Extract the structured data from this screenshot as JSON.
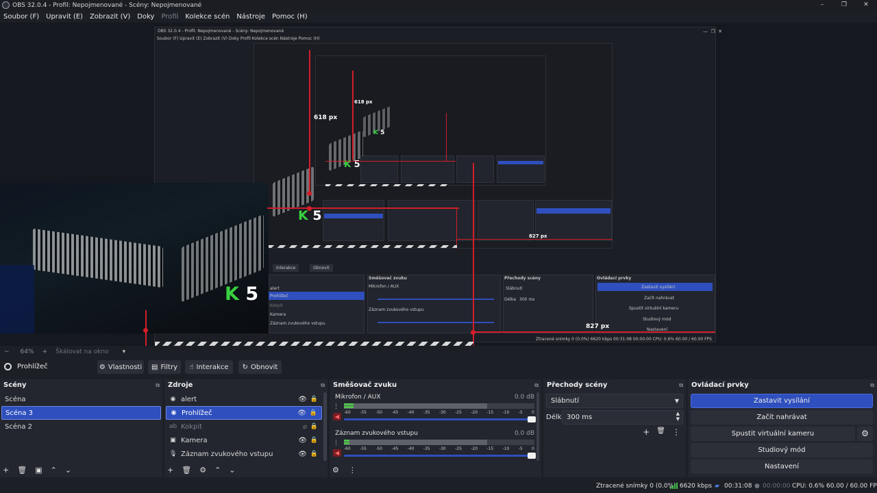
{
  "window": {
    "title": "OBS 32.0.4 - Profil: Nepojmenované - Scény: Nepojmenované",
    "controls": [
      "–",
      "❐",
      "✕"
    ]
  },
  "menu": [
    "Soubor (F)",
    "Upravit (E)",
    "Zobrazit (V)",
    "Doky",
    "Profil",
    "Kolekce scén",
    "Nástroje",
    "Pomoc (H)"
  ],
  "preview": {
    "px_label_1": "618 px",
    "px_label_2": "618 px",
    "px_label_3": "827 px",
    "px_label_4": "827 px",
    "logo": "5",
    "logo_k": "K",
    "nested_title": "OBS 32.0.4 - Profil: Nepojmenované - Scény: Nepojmenované",
    "nested_menu": "Soubor (F)   Upravit (E)   Zobrazit (V)   Doky   Profil   Kolekce scén   Nástroje   Pomoc (H)",
    "nested_interakce": "Interakce",
    "nested_obnovit": "Obnovit",
    "nested_sources": [
      "alert",
      "Prohlížeč",
      "Kokpit",
      "Kamera",
      "Záznam zvukového vstupu"
    ],
    "nested_mixer_title": "Směšovač zvuku",
    "nested_transitions_title": "Přechody scény",
    "nested_controls_title": "Ovládací prvky",
    "nested_controls": [
      "Zastavit vysílání",
      "Začít nahrávat",
      "Spustit virtuální kameru",
      "Studiový mód",
      "Nastavení"
    ],
    "nested_fade": "Slábnutí",
    "nested_duration_label": "Délka",
    "nested_duration": "300 ms",
    "nested_ch1": "Mikrofon / AUX",
    "nested_ch2": "Záznam zvukového vstupu",
    "nested_status": "Ztracené snímky 0 (0.0%)    6620 kbps    00:31:08    00:00:00    CPU: 0.6%    60.00 / 60.00 FPS"
  },
  "zoom": {
    "minus": "−",
    "value": "64%",
    "plus": "+",
    "scale_mode": "Škálovat na okno",
    "caret": "▾"
  },
  "source_toolbar": {
    "name": "Prohlížeč",
    "properties": "Vlastnosti",
    "filters": "Filtry",
    "interact": "Interakce",
    "refresh": "Obnovit"
  },
  "scenes": {
    "title": "Scény",
    "items": [
      {
        "label": "Scéna",
        "selected": false
      },
      {
        "label": "Scéna 3",
        "selected": true
      },
      {
        "label": "Scéna 2",
        "selected": false
      }
    ]
  },
  "sources": {
    "title": "Zdroje",
    "items": [
      {
        "label": "alert",
        "icon": "browser-icon",
        "selected": false,
        "hidden": false
      },
      {
        "label": "Prohlížeč",
        "icon": "browser-icon",
        "selected": true,
        "hidden": false
      },
      {
        "label": "Kokpit",
        "icon": "text-icon",
        "selected": false,
        "hidden": true
      },
      {
        "label": "Kamera",
        "icon": "camera-icon",
        "selected": false,
        "hidden": false
      },
      {
        "label": "Záznam zvukového vstupu",
        "icon": "microphone-icon",
        "selected": false,
        "hidden": false
      }
    ]
  },
  "mixer": {
    "title": "Směšovač zvuku",
    "channels": [
      {
        "name": "Mikrofon / AUX",
        "db": "0.0 dB",
        "level": 0.05
      },
      {
        "name": "Záznam zvukového vstupu",
        "db": "0.0 dB",
        "level": 0.03
      }
    ],
    "ticks": [
      "-60",
      "-55",
      "-50",
      "-45",
      "-40",
      "-35",
      "-30",
      "-25",
      "-20",
      "-15",
      "-10",
      "-5",
      "0"
    ]
  },
  "transitions": {
    "title": "Přechody scény",
    "selected": "Slábnutí",
    "duration_label": "Délka",
    "duration": "300 ms"
  },
  "controls": {
    "title": "Ovládací prvky",
    "stop_stream": "Zastavit vysílání",
    "start_record": "Začít nahrávat",
    "virtual_cam": "Spustit virtuální kameru",
    "studio_mode": "Studiový mód",
    "settings": "Nastavení"
  },
  "status": {
    "dropped": "Ztracené snímky 0 (0.0%)",
    "bitrate": "6620 kbps",
    "stream_time": "00:31:08",
    "record_time": "00:00:00",
    "cpu": "CPU: 0.6%",
    "fps": "60.00 / 60.00 FPS"
  },
  "colors": {
    "accent": "#2e4fbd",
    "panel": "#23262e",
    "background": "#1d1f26",
    "meter_green": "#4ec34a",
    "guide_red": "#d21e2a"
  }
}
